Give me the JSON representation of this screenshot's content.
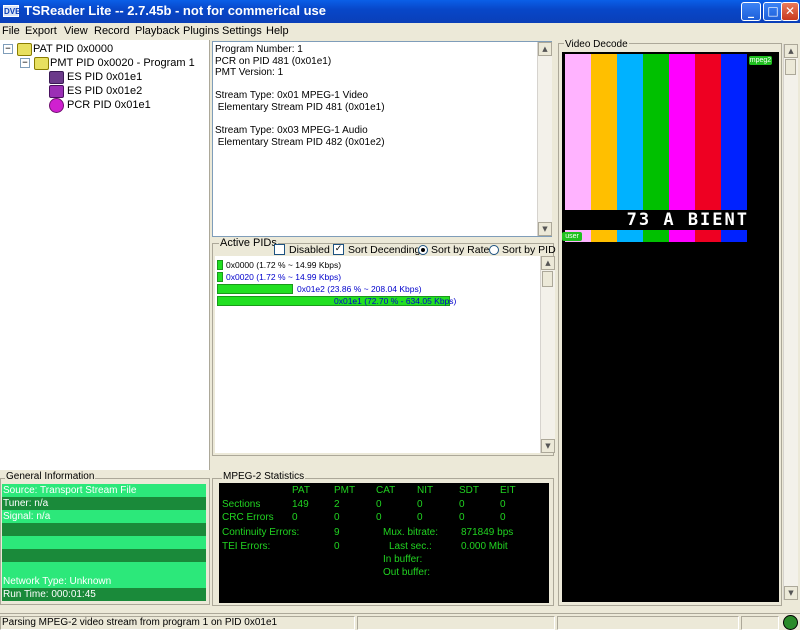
{
  "window": {
    "title": "TSReader Lite -- 2.7.45b - not for commerical use",
    "icon_label": "DVB",
    "minimize": "_",
    "maximize": "□",
    "close": "✕"
  },
  "menu": [
    "File",
    "Export",
    "View",
    "Record",
    "Playback",
    "Plugins",
    "Settings",
    "Help"
  ],
  "tree": [
    {
      "label": "PAT PID 0x0000",
      "icon": "pat-table-icon",
      "expander": "−"
    },
    {
      "label": "PMT PID 0x0020 - Program 1",
      "icon": "pmt-table-icon",
      "expander": "−"
    },
    {
      "label": "ES PID 0x01e1",
      "icon": "video-stream-icon"
    },
    {
      "label": "ES PID 0x01e2",
      "icon": "audio-stream-icon"
    },
    {
      "label": "PCR PID 0x01e1",
      "icon": "pcr-clock-icon"
    }
  ],
  "info_text": "Program Number: 1\nPCR on PID 481 (0x01e1)\nPMT Version: 1\n\nStream Type: 0x01 MPEG-1 Video\n Elementary Stream PID 481 (0x01e1)\n\nStream Type: 0x03 MPEG-1 Audio\n Elementary Stream PID 482 (0x01e2)",
  "active_pids": {
    "legend": "Active PIDs",
    "disabled_label": "Disabled",
    "disabled_checked": false,
    "sort_desc_label": "Sort Decending",
    "sort_desc_checked": true,
    "sort_check": "✓",
    "sort_rate_label": "Sort by Rate",
    "sort_pid_label": "Sort by PID",
    "sort_mode": "rate",
    "items": [
      {
        "label": "0x0000 (1.72 % ~ 14.99 Kbps)",
        "percent": 1.72
      },
      {
        "label": "0x0020 (1.72 % ~ 14.99 Kbps)",
        "percent": 1.72
      },
      {
        "label": "0x01e2 (23.86 % ~ 208.04 Kbps)",
        "percent": 23.86
      },
      {
        "label": "0x01e1 (72.70 % - 634.05 Kbps)",
        "percent": 72.7
      }
    ]
  },
  "general_info": {
    "legend": "General Information",
    "rows": [
      {
        "text": "Source: Transport Stream File",
        "shade": "light"
      },
      {
        "text": "Tuner: n/a",
        "shade": "dark"
      },
      {
        "text": "Signal: n/a",
        "shade": "light"
      },
      {
        "text": "",
        "shade": "dark"
      },
      {
        "text": "",
        "shade": "light"
      },
      {
        "text": "",
        "shade": "dark"
      },
      {
        "text": "",
        "shade": "light"
      },
      {
        "text": "",
        "shade": "dark"
      },
      {
        "text": "Network Type: Unknown",
        "shade": "light"
      },
      {
        "text": "Run Time: 000:01:45",
        "shade": "dark"
      }
    ]
  },
  "mpeg_stats": {
    "legend": "MPEG-2 Statistics",
    "headers": [
      "PAT",
      "PMT",
      "CAT",
      "NIT",
      "SDT",
      "EIT"
    ],
    "sections_label": "Sections",
    "sections": [
      "149",
      "2",
      "0",
      "0",
      "0",
      "0"
    ],
    "crc_label": "CRC Errors",
    "crc": [
      "0",
      "0",
      "0",
      "0",
      "0",
      "0"
    ],
    "continuity_label": "Continuity Errors:",
    "continuity_value": "9",
    "tei_label": "TEI Errors:",
    "tei_value": "0",
    "mux_label": "Mux. bitrate:",
    "mux_value": "871849 bps",
    "last_label": "Last sec.:",
    "last_value": "0.000 Mbit",
    "inbuf_label": "In buffer:",
    "outbuf_label": "Out buffer:"
  },
  "video": {
    "legend": "Video Decode",
    "badge_top": "mpeg2",
    "caption": "73 A BIENT",
    "badge_bottom": "user",
    "bar_colors": [
      "#ffb3ff",
      "#ffbf00",
      "#00b2ff",
      "#00c000",
      "#ff00ff",
      "#ee0022",
      "#0022ff"
    ],
    "bottom_colors": [
      "#ffb3ff",
      "#ffbf00",
      "#00b2ff",
      "#00c000",
      "#ff00ff",
      "#ee0022",
      "#0022ff"
    ]
  },
  "status": {
    "text": "Parsing MPEG-2 video stream from program 1 on PID 0x01e1"
  }
}
